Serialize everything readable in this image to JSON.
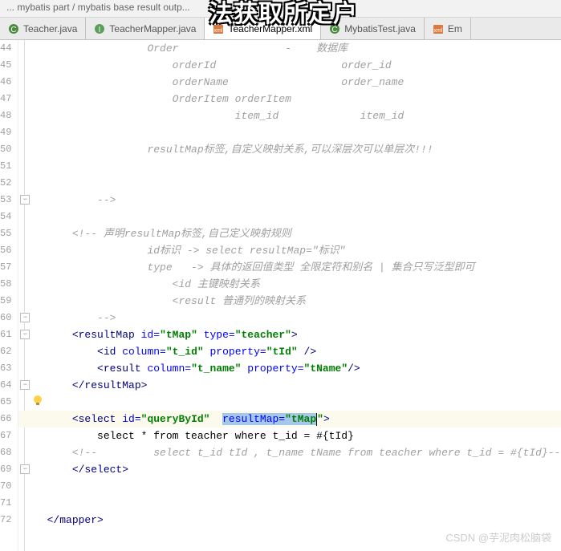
{
  "breadcrumb": "... mybatis part / mybatis base result outp...",
  "overlay_title": "法获取所定户",
  "tabs": [
    {
      "label": "Teacher.java",
      "icon": "class",
      "active": false
    },
    {
      "label": "TeacherMapper.java",
      "icon": "interface",
      "active": false
    },
    {
      "label": "TeacherMapper.xml",
      "icon": "xml",
      "active": true
    },
    {
      "label": "MybatisTest.java",
      "icon": "class",
      "active": false
    },
    {
      "label": "Em",
      "icon": "xml",
      "active": false
    }
  ],
  "line_start": 44,
  "line_end": 72,
  "code_lines": [
    {
      "n": 44,
      "indent": 20,
      "type": "comment",
      "text": "Order                 -    数据库"
    },
    {
      "n": 45,
      "indent": 24,
      "type": "comment",
      "text": "orderId                    order_id"
    },
    {
      "n": 46,
      "indent": 24,
      "type": "comment",
      "text": "orderName                  order_name"
    },
    {
      "n": 47,
      "indent": 24,
      "type": "comment",
      "text": "OrderItem orderItem"
    },
    {
      "n": 48,
      "indent": 34,
      "type": "comment",
      "text": "item_id             item_id"
    },
    {
      "n": 49,
      "indent": 0,
      "type": "blank",
      "text": ""
    },
    {
      "n": 50,
      "indent": 20,
      "type": "comment",
      "text": "resultMap标签,自定义映射关系,可以深层次可以单层次!!!"
    },
    {
      "n": 51,
      "indent": 0,
      "type": "blank",
      "text": ""
    },
    {
      "n": 52,
      "indent": 0,
      "type": "blank",
      "text": ""
    },
    {
      "n": 53,
      "indent": 12,
      "type": "comment",
      "text": "-->"
    },
    {
      "n": 54,
      "indent": 0,
      "type": "blank",
      "text": ""
    },
    {
      "n": 55,
      "indent": 8,
      "type": "comment",
      "text": "<!-- 声明resultMap标签,自己定义映射规则"
    },
    {
      "n": 56,
      "indent": 20,
      "type": "comment",
      "text": "id标识 -> select resultMap=\"标识\""
    },
    {
      "n": 57,
      "indent": 20,
      "type": "comment",
      "text": "type   -> 具体的返回值类型 全限定符和别名 | 集合只写泛型即可"
    },
    {
      "n": 58,
      "indent": 24,
      "type": "comment",
      "text": "<id 主键映射关系"
    },
    {
      "n": 59,
      "indent": 24,
      "type": "comment",
      "text": "<result 普通列的映射关系"
    },
    {
      "n": 60,
      "indent": 12,
      "type": "comment",
      "text": "-->"
    },
    {
      "n": 61,
      "indent": 8,
      "type": "xml",
      "raw": "<resultMap id=\"tMap\" type=\"teacher\">",
      "tag": "resultMap",
      "attrs": [
        [
          "id",
          "tMap"
        ],
        [
          "type",
          "teacher"
        ]
      ],
      "close": ">"
    },
    {
      "n": 62,
      "indent": 12,
      "type": "xml",
      "raw": "<id column=\"t_id\" property=\"tId\" />",
      "tag": "id",
      "attrs": [
        [
          "column",
          "t_id"
        ],
        [
          "property",
          "tId"
        ]
      ],
      "close": " />"
    },
    {
      "n": 63,
      "indent": 12,
      "type": "xml",
      "raw": "<result  column=\"t_name\" property=\"tName\"/>",
      "tag": "result",
      "attrs": [
        [
          "column",
          "t_name"
        ],
        [
          "property",
          "tName"
        ]
      ],
      "close": "/>"
    },
    {
      "n": 64,
      "indent": 8,
      "type": "xml-close",
      "tag": "resultMap"
    },
    {
      "n": 65,
      "indent": 0,
      "type": "blank",
      "text": "",
      "bulb": true
    },
    {
      "n": 66,
      "indent": 8,
      "type": "xml-select",
      "highlight": true,
      "tag": "select",
      "attrs": [
        [
          "id",
          "queryById"
        ]
      ],
      "sel_attr": [
        "resultMap",
        "tMap"
      ],
      "close": ">"
    },
    {
      "n": 67,
      "indent": 12,
      "type": "text",
      "text": "select * from teacher where t_id = #{tId}"
    },
    {
      "n": 68,
      "indent": 8,
      "type": "comment",
      "text": "<!--         select t_id tId , t_name tName from teacher where t_id = #{tId}-->"
    },
    {
      "n": 69,
      "indent": 8,
      "type": "xml-close",
      "tag": "select"
    },
    {
      "n": 70,
      "indent": 0,
      "type": "blank",
      "text": ""
    },
    {
      "n": 71,
      "indent": 0,
      "type": "blank",
      "text": ""
    },
    {
      "n": 72,
      "indent": 4,
      "type": "xml-close",
      "tag": "mapper"
    }
  ],
  "watermark": "CSDN @芋泥肉松脑袋"
}
